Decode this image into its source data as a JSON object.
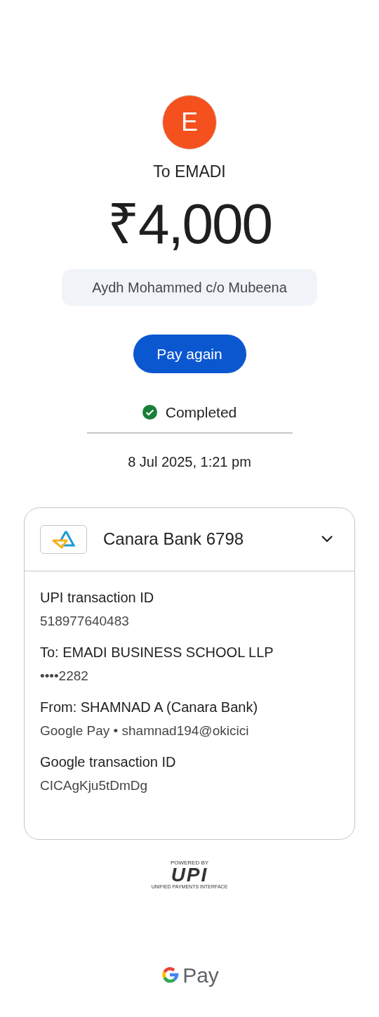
{
  "avatar": {
    "letter": "E",
    "color": "#f4511e"
  },
  "recipient": "To EMADI",
  "amount": "₹4,000",
  "note": "Aydh Mohammed c/o Mubeena",
  "pay_again_button": "Pay again",
  "status": "Completed",
  "date": "8 Jul 2025, 1:21 pm",
  "account": {
    "name": "Canara Bank 6798"
  },
  "details": [
    {
      "label": "UPI transaction ID",
      "value": "518977640483"
    },
    {
      "label": "To: EMADI BUSINESS SCHOOL LLP",
      "value": "••••2282"
    },
    {
      "label": "From: SHAMNAD A (Canara Bank)",
      "value": "Google Pay • shamnad194@okicici"
    },
    {
      "label": "Google transaction ID",
      "value": "CICAgKju5tDmDg"
    }
  ],
  "upi_badge": {
    "powered_by": "POWERED BY",
    "brand": "UPI",
    "tagline": "UNIFIED PAYMENTS INTERFACE"
  },
  "footer_brand": "Pay"
}
